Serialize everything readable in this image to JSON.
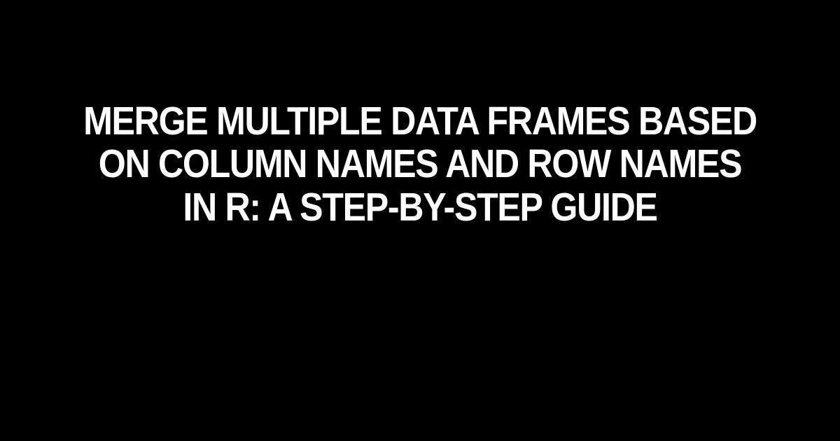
{
  "title": "Merge Multiple Data Frames Based on Column Names and Row Names in R: A Step-by-Step Guide"
}
